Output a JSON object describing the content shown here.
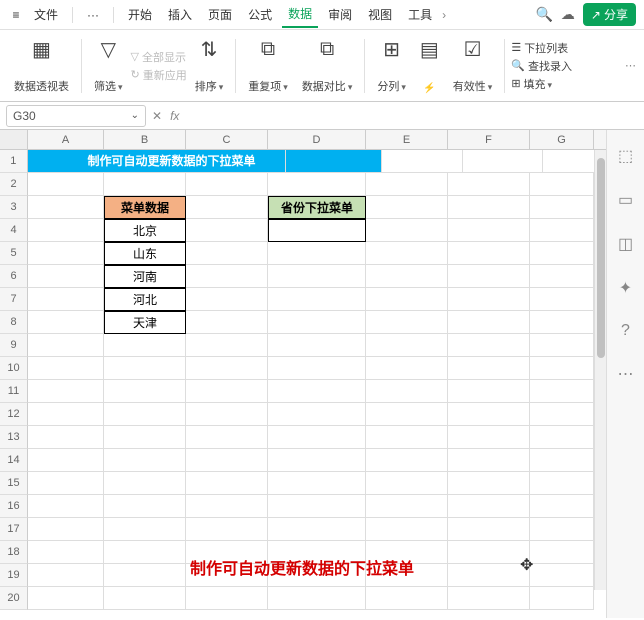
{
  "topbar": {
    "file": "文件",
    "more": "···",
    "tabs": [
      "开始",
      "插入",
      "页面",
      "公式",
      "数据",
      "审阅",
      "视图",
      "工具"
    ],
    "activeTab": 4,
    "share": "分享"
  },
  "ribbon": {
    "pivot": "数据透视表",
    "filter": "筛选",
    "showAll": "全部显示",
    "reapply": "重新应用",
    "sort": "排序",
    "dup": "重复项",
    "compare": "数据对比",
    "split": "分列",
    "fill": "智能填充",
    "validity": "有效性",
    "insertDD": "下拉列表",
    "findInput": "查找录入",
    "fillDown": "填充"
  },
  "namebox": {
    "ref": "G30",
    "fx": "fx"
  },
  "columns": [
    "A",
    "B",
    "C",
    "D",
    "E",
    "F",
    "G"
  ],
  "rows": [
    1,
    2,
    3,
    4,
    5,
    6,
    7,
    8,
    9,
    10,
    11,
    12,
    13,
    14,
    15,
    16,
    17,
    18,
    19,
    20
  ],
  "cells": {
    "banner": "制作可自动更新数据的下拉菜单",
    "b3": "菜单数据",
    "b4": "北京",
    "b5": "山东",
    "b6": "河南",
    "b7": "河北",
    "b8": "天津",
    "d3": "省份下拉菜单"
  },
  "footerText": "制作可自动更新数据的下拉菜单"
}
